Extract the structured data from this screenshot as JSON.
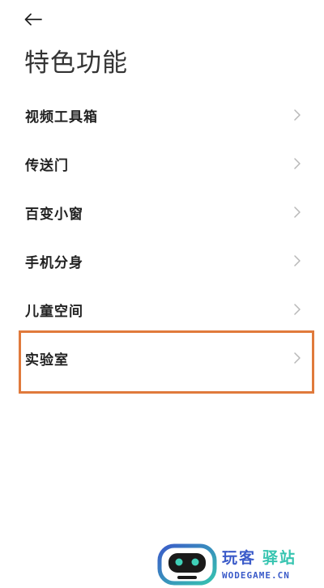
{
  "header": {
    "back_icon": "back-arrow-icon",
    "title": "特色功能"
  },
  "list": {
    "items": [
      {
        "label": "视频工具箱"
      },
      {
        "label": "传送门"
      },
      {
        "label": "百变小窗"
      },
      {
        "label": "手机分身"
      },
      {
        "label": "儿童空间"
      },
      {
        "label": "实验室"
      }
    ],
    "chevron_icon": "chevron-right-icon"
  },
  "watermark": {
    "name_part1": "玩客",
    "name_part2": "驿站",
    "url": "WODEGAME.CN"
  },
  "colors": {
    "highlight_border": "#e07a3c",
    "brand_blue": "#3b5bc9",
    "brand_teal": "#36c4b0",
    "chevron": "#b8b8b8"
  }
}
